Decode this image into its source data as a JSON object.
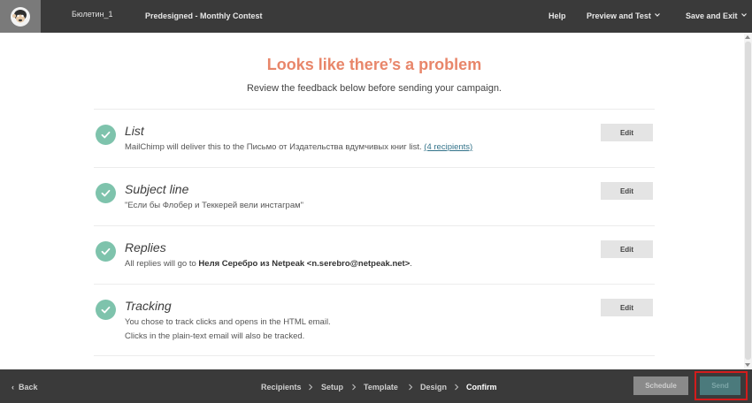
{
  "header": {
    "campaign_name": "Бюлетин_1",
    "campaign_title": "Predesigned - Monthly Contest",
    "help_label": "Help",
    "preview_label": "Preview and Test",
    "save_label": "Save and Exit"
  },
  "main": {
    "heading": "Looks like there’s a problem",
    "subheading": "Review the feedback below before sending your campaign.",
    "sections": [
      {
        "title": "List",
        "text_prefix": "MailChimp will deliver this to the Письмо от Издательства вдумчивых книг list. ",
        "link": "(4 recipients)",
        "edit_label": "Edit"
      },
      {
        "title": "Subject line",
        "text": "\"Если бы Флобер и Теккерей вели инстаграм\"",
        "edit_label": "Edit"
      },
      {
        "title": "Replies",
        "text_prefix": "All replies will go to ",
        "bold": "Неля Серебро из Netpeak <n.serebro@netpeak.net>",
        "text_suffix": ".",
        "edit_label": "Edit"
      },
      {
        "title": "Tracking",
        "text": "You chose to track clicks and opens in the HTML email.",
        "text2": "Clicks in the plain-text email will also be tracked.",
        "edit_label": "Edit"
      }
    ]
  },
  "footer": {
    "back_label": "Back",
    "steps": [
      "Recipients",
      "Setup",
      "Template",
      "Design",
      "Confirm"
    ],
    "active_step": "Confirm",
    "schedule_label": "Schedule",
    "send_label": "Send"
  },
  "colors": {
    "heading": "#e8866a",
    "check": "#7ec3ac",
    "link": "#33738a",
    "send_highlight": "#d31c1c"
  }
}
